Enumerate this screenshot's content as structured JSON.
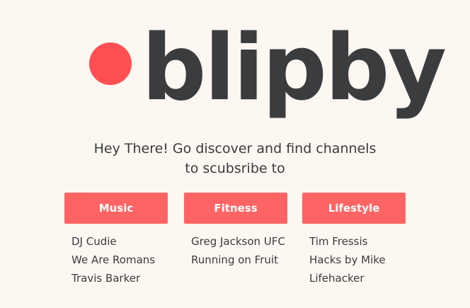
{
  "logo": {
    "text": "blipby",
    "dot_color": "#ff4f52"
  },
  "tagline": {
    "line1": "Hey There! Go discover and find channels",
    "line2": "to scubsribe to"
  },
  "accent_color": "#ff6464",
  "categories": [
    {
      "label": "Music",
      "channels": [
        "DJ Cudie",
        "We Are Romans",
        "Travis Barker"
      ]
    },
    {
      "label": "Fitness",
      "channels": [
        "Greg Jackson UFC",
        "Running on Fruit"
      ]
    },
    {
      "label": "Lifestyle",
      "channels": [
        "Tim Fressis",
        "Hacks by Mike",
        "Lifehacker"
      ]
    }
  ]
}
